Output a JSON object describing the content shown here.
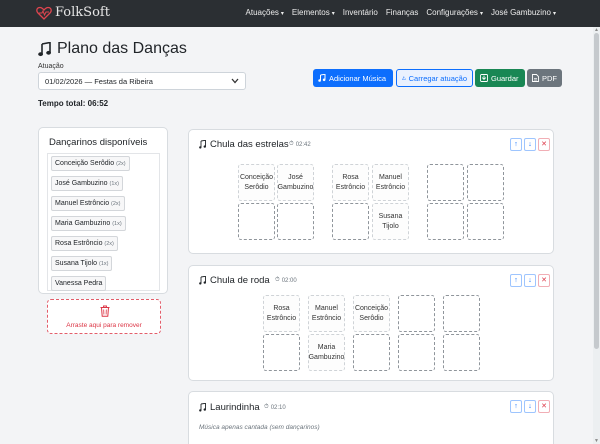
{
  "navbar": {
    "brand": "FolkSoft",
    "items": [
      {
        "label": "Atuações",
        "caret": true
      },
      {
        "label": "Elementos",
        "caret": true
      },
      {
        "label": "Inventário",
        "caret": false
      },
      {
        "label": "Finanças",
        "caret": false
      },
      {
        "label": "Configurações",
        "caret": true
      },
      {
        "label": "José Gambuzino",
        "caret": true
      }
    ]
  },
  "page": {
    "title": "Plano das Danças",
    "performance_label": "Atuação",
    "performance_value": "01/02/2026 — Festas da Ribeira",
    "total_time": "Tempo total: 06:52"
  },
  "toolbar": {
    "add_music": "Adicionar Música",
    "load_performance": "Carregar atuação",
    "save": "Guardar",
    "pdf": "PDF"
  },
  "dancers_panel": {
    "title": "Dançarinos disponíveis",
    "dancers": [
      {
        "name": "Conceição Serôdio",
        "count": "(2x)"
      },
      {
        "name": "José Gambuzino",
        "count": "(1x)"
      },
      {
        "name": "Manuel Estrôncio",
        "count": "(2x)"
      },
      {
        "name": "Maria Gambuzino",
        "count": "(1x)"
      },
      {
        "name": "Rosa Estrôncio",
        "count": "(2x)"
      },
      {
        "name": "Susana Tijolo",
        "count": "(1x)"
      },
      {
        "name": "Vanessa Pedra",
        "count": ""
      }
    ],
    "remove_zone": "Arraste aqui para remover"
  },
  "dances": [
    {
      "name": "Chula das estrelas",
      "duration": "02:42",
      "slots": [
        "Conceição Serôdio",
        "José Gambuzino",
        "",
        "",
        "Rosa Estrôncio",
        "Manuel Estrôncio",
        "",
        "Susana Tijolo",
        "",
        "",
        "",
        ""
      ]
    },
    {
      "name": "Chula de roda",
      "duration": "02:00",
      "slots": [
        "Rosa Estrôncio",
        "Manuel Estrôncio",
        "Conceição Serôdio",
        "",
        "",
        "",
        "Maria Gambuzino",
        "",
        "",
        ""
      ]
    },
    {
      "name": "Laurindinha",
      "duration": "02:10",
      "note": "Música apenas cantada (sem dançarinos)"
    }
  ],
  "controls": {
    "up": "↑",
    "down": "↓",
    "delete": "✕"
  },
  "colors": {
    "navbar": "#2b2f33",
    "primary": "#0d6efd",
    "success": "#198754",
    "secondary": "#6c757d",
    "danger": "#dc3545",
    "brand_heart": "#e0454f"
  }
}
